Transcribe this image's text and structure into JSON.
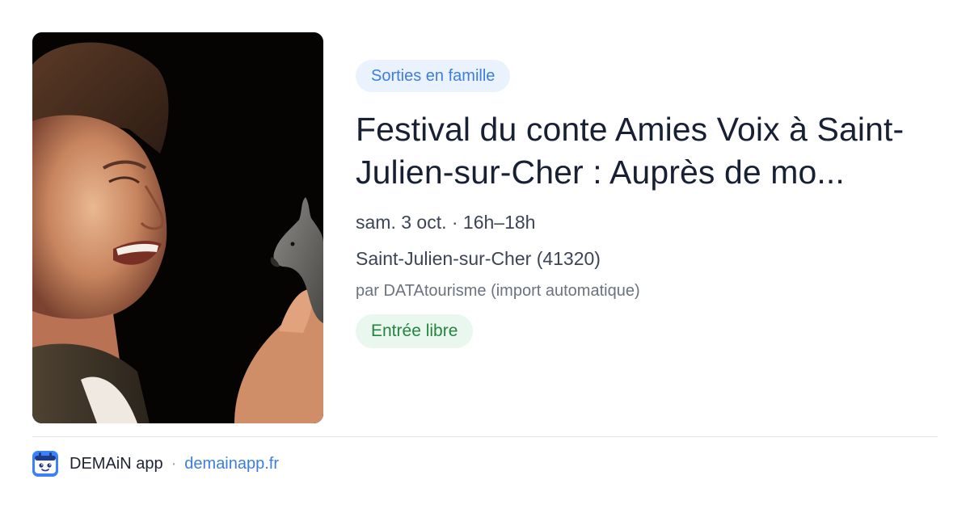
{
  "event": {
    "category": "Sorties en famille",
    "title": "Festival du conte Amies Voix à Saint-Julien-sur-Cher : Auprès de mo...",
    "date_time": "sam. 3 oct. · 16h–18h",
    "location": "Saint-Julien-sur-Cher (41320)",
    "source": "par DATAtourisme (import automatique)",
    "price": "Entrée libre",
    "image_alt": "Conteuse souriante tenant une figurine d'âne"
  },
  "footer": {
    "app_name": "DEMAiN app",
    "separator": "·",
    "domain": "demainapp.fr",
    "logo_icon": "app-logo-icon"
  },
  "colors": {
    "accent_blue": "#3d7de0",
    "category_bg": "#eaf2fe",
    "price_green": "#24853f",
    "price_bg": "#eaf7ee",
    "title_text": "#182033",
    "muted_text": "#6b7280",
    "divider": "#dfe3e8"
  }
}
